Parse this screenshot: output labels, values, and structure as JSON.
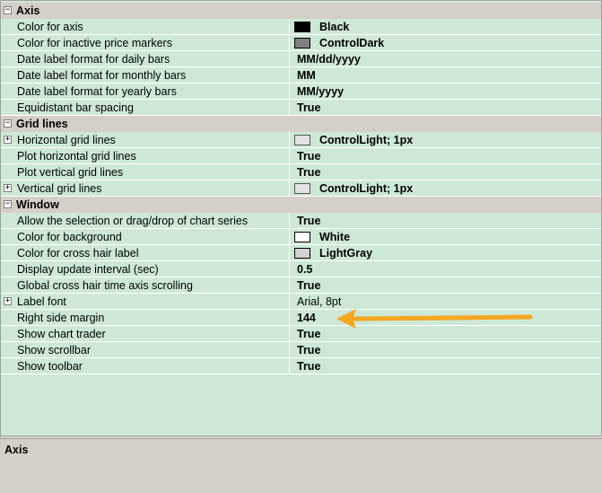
{
  "categories": {
    "axis": "Axis",
    "grid": "Grid lines",
    "window": "Window"
  },
  "axis": [
    {
      "label": "Color for axis",
      "value": "Black",
      "swatch": "#000000"
    },
    {
      "label": "Color for inactive price markers",
      "value": "ControlDark",
      "swatch": "#808080"
    },
    {
      "label": "Date label format for daily bars",
      "value": "MM/dd/yyyy"
    },
    {
      "label": "Date label format for monthly bars",
      "value": "MM"
    },
    {
      "label": "Date label format for yearly bars",
      "value": "MM/yyyy"
    },
    {
      "label": "Equidistant bar spacing",
      "value": "True"
    }
  ],
  "grid": [
    {
      "label": "Horizontal grid lines",
      "value": "ControlLight; 1px",
      "swatch": "#e3e3e3"
    },
    {
      "label": "Plot horizontal grid lines",
      "value": "True"
    },
    {
      "label": "Plot vertical grid lines",
      "value": "True"
    },
    {
      "label": "Vertical grid lines",
      "value": "ControlLight; 1px",
      "swatch": "#e3e3e3"
    }
  ],
  "window": [
    {
      "label": "Allow the selection or drag/drop of chart series",
      "value": "True"
    },
    {
      "label": "Color for background",
      "value": "White",
      "swatch": "#ffffff"
    },
    {
      "label": "Color for cross hair label",
      "value": "LightGray",
      "swatch": "#d3d3d3"
    },
    {
      "label": "Display update interval (sec)",
      "value": "0.5"
    },
    {
      "label": "Global cross hair time axis scrolling",
      "value": "True"
    },
    {
      "label": "Label font",
      "value": "Arial, 8pt"
    },
    {
      "label": "Right side margin",
      "value": "144"
    },
    {
      "label": "Show chart trader",
      "value": "True"
    },
    {
      "label": "Show scrollbar",
      "value": "True"
    },
    {
      "label": "Show toolbar",
      "value": "True"
    }
  ],
  "description": {
    "title": "Axis"
  },
  "glyphs": {
    "collapse": "−",
    "expand": "+"
  },
  "colors": {
    "grid_bg": "#cde9d6",
    "category_bg": "#d4d0c8",
    "arrow": "#f5a623"
  }
}
